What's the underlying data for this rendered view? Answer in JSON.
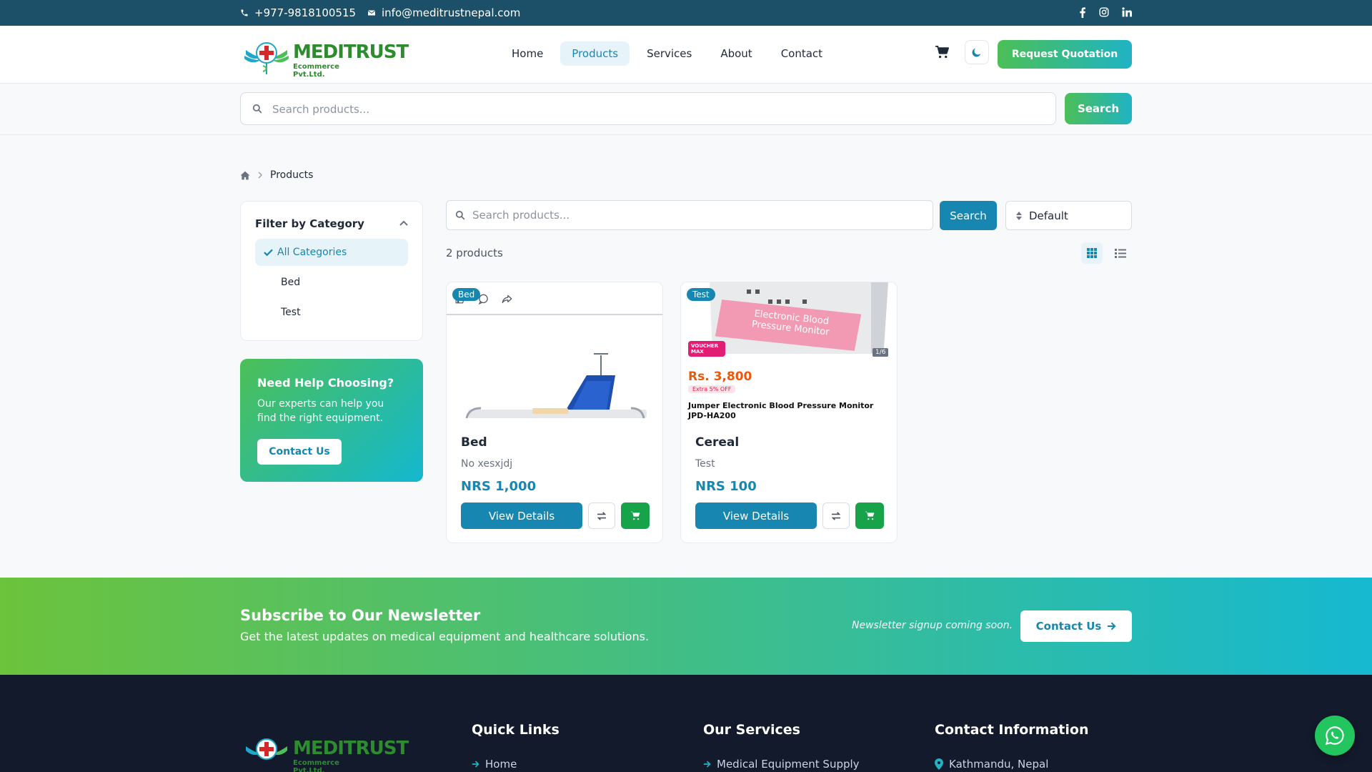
{
  "topbar": {
    "phone": "+977-9818100515",
    "email": "info@meditrustnepal.com",
    "social": [
      "facebook-icon",
      "instagram-icon",
      "linkedin-icon"
    ]
  },
  "brand": {
    "logo_text": "MEDITRUST",
    "logo_sub": "Ecommerce Pvt.Ltd."
  },
  "nav": {
    "items": [
      "Home",
      "Products",
      "Services",
      "About",
      "Contact"
    ],
    "active": "Products",
    "quote_label": "Request Quotation"
  },
  "search": {
    "placeholder": "Search products...",
    "button": "Search"
  },
  "breadcrumb": {
    "current": "Products"
  },
  "filter": {
    "title": "Filter by Category",
    "categories": [
      "All Categories",
      "Bed",
      "Test"
    ],
    "active": "All Categories"
  },
  "help": {
    "title": "Need Help Choosing?",
    "text": "Our experts can help you find the right equipment.",
    "button": "Contact Us"
  },
  "listing": {
    "search_placeholder": "Search products...",
    "search_button": "Search",
    "sort_value": "Default",
    "count_text": "2 products"
  },
  "products": [
    {
      "badge": "Bed",
      "name": "Bed",
      "description": "No xesxjdj",
      "price": "NRS 1,000",
      "view_label": "View Details"
    },
    {
      "badge": "Test",
      "name": "Cereal",
      "description": "Test",
      "price": "NRS 100",
      "view_label": "View Details",
      "image_text": {
        "box_label_1": "Electronic Blood",
        "box_label_2": "Pressure Monitor",
        "voucher": "VOUCHER MAX",
        "price": "Rs. 3,800",
        "extra": "Extra 5% OFF",
        "counter": "1/6",
        "title_1": "Jumper Electronic Blood Pressure Monitor",
        "title_2": "JPD-HA200"
      }
    }
  ],
  "newsletter": {
    "title": "Subscribe to Our Newsletter",
    "subtitle": "Get the latest updates on medical equipment and healthcare solutions.",
    "note": "Newsletter signup coming soon.",
    "button": "Contact Us"
  },
  "footer": {
    "quick_links_title": "Quick Links",
    "services_title": "Our Services",
    "contact_title": "Contact Information",
    "quick_link_1": "Home",
    "service_1": "Medical Equipment Supply",
    "contact_1": "Kathmandu, Nepal"
  },
  "colors": {
    "primary": "#1786b0",
    "green": "#4cbf57",
    "topbar": "#1c5068",
    "footer": "#131a2b"
  }
}
